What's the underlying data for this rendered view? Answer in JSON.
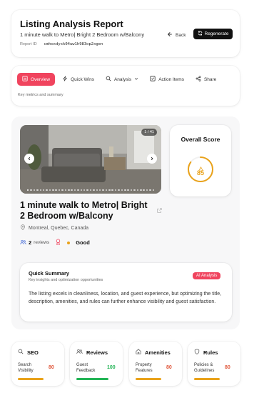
{
  "header": {
    "title": "Listing Analysis Report",
    "subtitle": "1 minute walk to Metro| Bright 2 Bedroom w/Balcony",
    "report_id_label": "Report ID",
    "report_id": "cmhoxdysk04uw1h983op2xgen",
    "back_label": "Back",
    "regenerate_label": "Regenerate"
  },
  "tabs": {
    "items": [
      {
        "label": "Overview",
        "icon": "bar-chart-icon",
        "active": true
      },
      {
        "label": "Quick Wins",
        "icon": "lightning-icon",
        "active": false
      },
      {
        "label": "Analysis",
        "icon": "search-icon",
        "active": false
      },
      {
        "label": "Action Items",
        "icon": "checkbox-icon",
        "active": false
      },
      {
        "label": "Share",
        "icon": "share-icon",
        "active": false
      }
    ],
    "hint": "Key metrics and summary"
  },
  "photo": {
    "counter": "1 / 41",
    "total_photos": 41,
    "current_photo": 1
  },
  "score": {
    "label": "Overall Score",
    "value": "85",
    "percent": 85,
    "color": "#e9a21a"
  },
  "listing": {
    "title": "1 minute walk to Metro| Bright 2 Bedroom w/Balcony",
    "location": "Montreal, Quebec, Canada",
    "reviews_count": "2",
    "reviews_label": "reviews",
    "rating_label": "Good"
  },
  "quick_summary": {
    "title": "Quick Summary",
    "subtitle": "Key insights and optimization opportunities",
    "badge": "AI Analysis",
    "body": "The listing excels in cleanliness, location, and guest experience, but optimizing the title, description, amenities, and rules can further enhance visibility and guest satisfaction."
  },
  "metrics": [
    {
      "title": "SEO",
      "icon": "search-icon",
      "label": "Search Visibility",
      "value": "80",
      "percent": 80,
      "color": "#e9a21a"
    },
    {
      "title": "Reviews",
      "icon": "users-icon",
      "label": "Guest Feedback",
      "value": "100",
      "percent": 100,
      "color": "#22b455"
    },
    {
      "title": "Amenities",
      "icon": "home-icon",
      "label": "Property Features",
      "value": "80",
      "percent": 80,
      "color": "#e9a21a"
    },
    {
      "title": "Rules",
      "icon": "shield-icon",
      "label": "Policies & Guidelines",
      "value": "80",
      "percent": 80,
      "color": "#e9a21a"
    }
  ],
  "colors": {
    "accent": "#f0445e",
    "warning": "#e9a21a",
    "success": "#22b455",
    "dark": "#111111"
  }
}
